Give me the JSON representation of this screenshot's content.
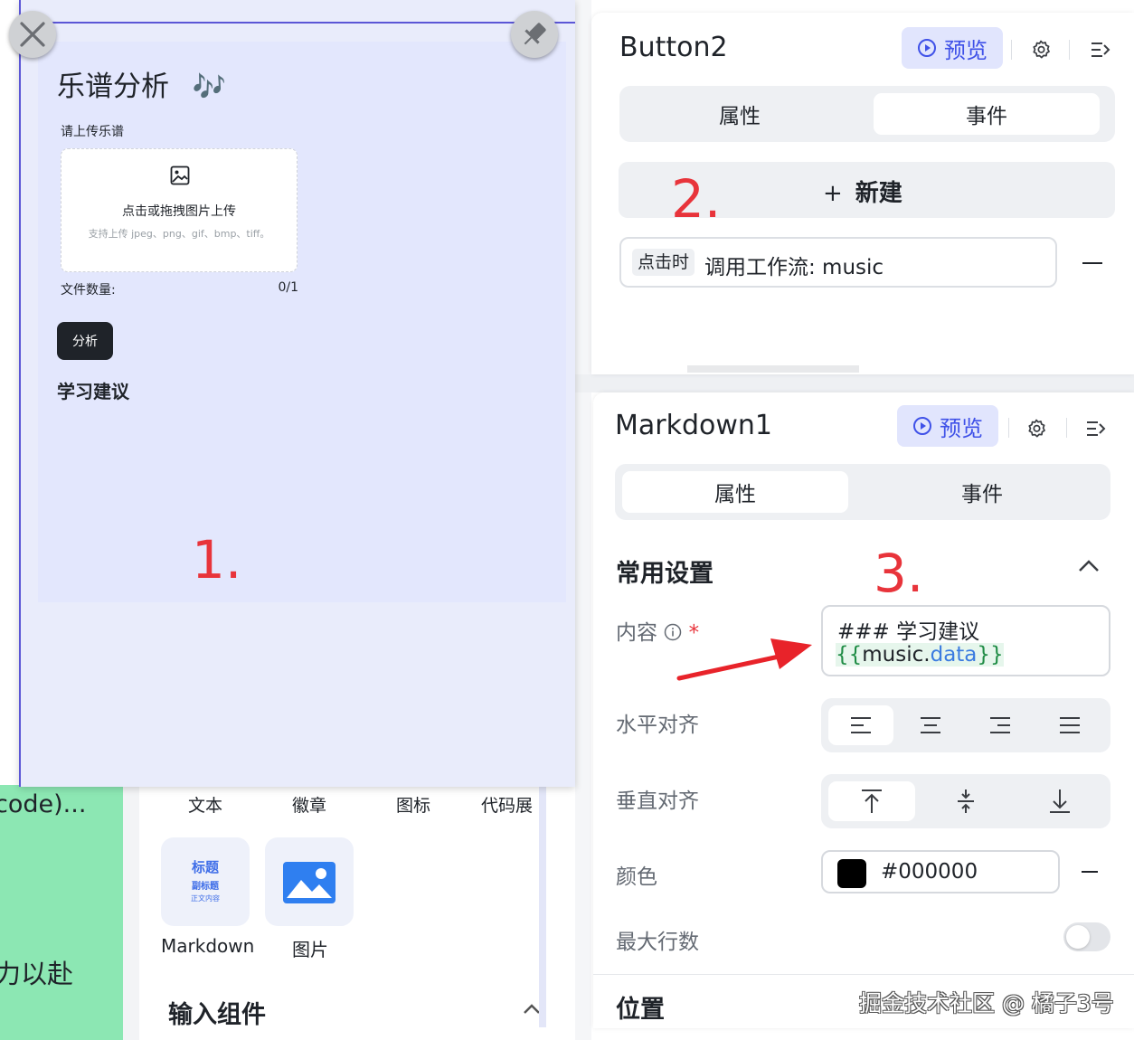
{
  "background": {
    "green_panel": {
      "line1": "code)...",
      "line2": "力以赴"
    },
    "component_library": {
      "tabs": [
        "文本",
        "徽章",
        "图标",
        "代码展"
      ],
      "items": [
        {
          "label": "Markdown",
          "icon": "markdown-thumbnail-icon",
          "thumbnail_lines": [
            "标题",
            "副标题",
            "正文内容"
          ]
        },
        {
          "label": "图片",
          "icon": "image-thumbnail-icon"
        }
      ],
      "section": "输入组件"
    }
  },
  "app_preview": {
    "title": "乐谱分析",
    "title_emoji": "🎶",
    "upload_label": "请上传乐谱",
    "upload_text": "点击或拖拽图片上传",
    "upload_hint": "支持上传 jpeg、png、gif、bmp、tiff。",
    "file_count_label": "文件数量:",
    "file_count_value": "0/1",
    "analyze_button": "分析",
    "study_heading": "学习建议",
    "step_marker": "1."
  },
  "button_panel": {
    "title": "Button2",
    "preview_label": "预览",
    "tabs": [
      "属性",
      "事件"
    ],
    "active_tab": "事件",
    "new_label": "新建",
    "step_marker": "2.",
    "event": {
      "trigger": "点击时",
      "action": "调用工作流: music"
    }
  },
  "markdown_panel": {
    "title": "Markdown1",
    "preview_label": "预览",
    "tabs": [
      "属性",
      "事件"
    ],
    "active_tab": "属性",
    "section_title": "常用设置",
    "step_marker": "3.",
    "content_label": "内容",
    "content_required": "*",
    "content_line1": "### 学习建议",
    "content_var_open": "{{",
    "content_var_obj": "music.",
    "content_var_prop": "data",
    "content_var_close": "}}",
    "h_align_label": "水平对齐",
    "h_align_options": [
      "align-left",
      "align-center",
      "align-right",
      "align-justify"
    ],
    "h_align_selected": "align-left",
    "v_align_label": "垂直对齐",
    "v_align_options": [
      "align-top",
      "align-middle",
      "align-bottom"
    ],
    "v_align_selected": "align-top",
    "color_label": "颜色",
    "color_value": "#000000",
    "max_lines_label": "最大行数",
    "max_lines_enabled": false,
    "position_title": "位置"
  },
  "watermark": "掘金技术社区 @ 橘子3号",
  "colors": {
    "accent": "#3f51e8",
    "annotation_red": "#e8343b",
    "preview_bg": "#e1e5fd",
    "app_bg": "#e3e7fd"
  }
}
